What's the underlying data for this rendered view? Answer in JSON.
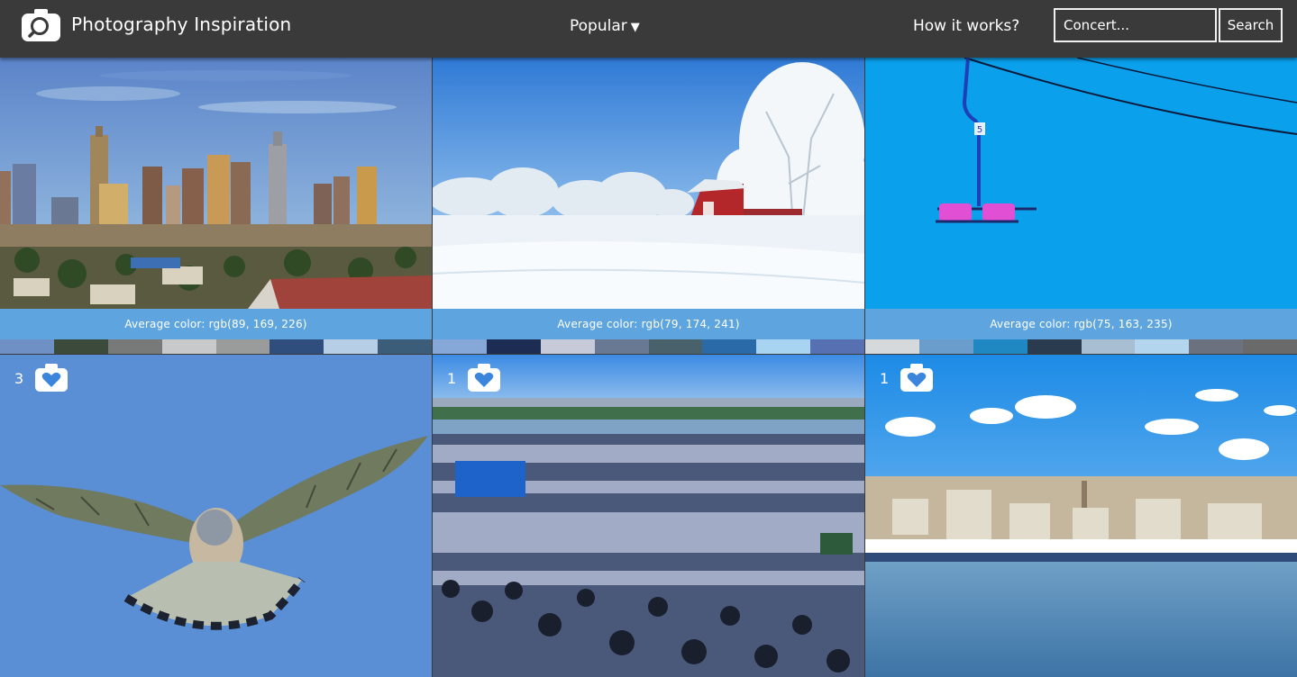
{
  "header": {
    "brand": "Photography Inspiration",
    "popular_label": "Popular",
    "how_label": "How it works?",
    "search_placeholder": "Concert...",
    "search_button": "Search"
  },
  "top_tiles": [
    {
      "subject": "city skyline",
      "avg_label": "Average color: rgb(89, 169, 226)",
      "avg_color": "#59a9e2",
      "palette": [
        "#6f90c4",
        "#3c4a3c",
        "#777a78",
        "#c7c9ca",
        "#9a9c9c",
        "#2f4e7e",
        "#b6cfe6",
        "#3b5d79"
      ]
    },
    {
      "subject": "snowy barn",
      "avg_label": "Average color: rgb(79, 174, 241)",
      "avg_color": "#4faef1",
      "palette": [
        "#85a8d8",
        "#1d2c52",
        "#c7cad9",
        "#6a7993",
        "#49616b",
        "#2a6aa9",
        "#a8d4f2",
        "#5670b2"
      ]
    },
    {
      "subject": "chairlift",
      "avg_label": "Average color: rgb(75, 163, 235)",
      "avg_color": "#4ba3eb",
      "palette": [
        "#d6d9db",
        "#6a9dcb",
        "#1f87c1",
        "#2a3b50",
        "#a7bed3",
        "#b3d6ee",
        "#6c7180",
        "#6a6a6a"
      ]
    }
  ],
  "bottom_tiles": [
    {
      "subject": "kestrel",
      "count": "3"
    },
    {
      "subject": "festival crowd",
      "count": "1"
    },
    {
      "subject": "waterfront city",
      "count": "1"
    }
  ],
  "icons": {
    "logo": "camera-search-icon",
    "favorite": "camera-heart-icon"
  }
}
